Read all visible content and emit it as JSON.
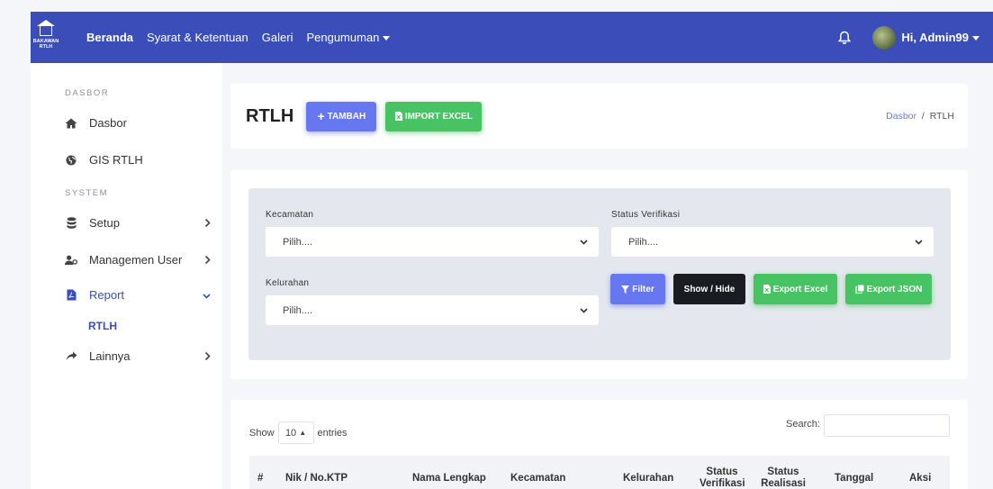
{
  "navbar": {
    "brand_line1": "BAKAWAN",
    "brand_line2": "RTLH",
    "links": [
      "Beranda",
      "Syarat & Ketentuan",
      "Galeri",
      "Pengumuman"
    ],
    "user": "Hi, Admin99"
  },
  "sidebar": {
    "section_dasbor": "DASBOR",
    "dasbor": "Dasbor",
    "gis": "GIS RTLH",
    "section_system": "SYSTEM",
    "setup": "Setup",
    "managemen_user": "Managemen User",
    "report": "Report",
    "report_sub": "RTLH",
    "lainnya": "Lainnya"
  },
  "header": {
    "title": "RTLH",
    "tambah": "TAMBAH",
    "import": "IMPORT EXCEL",
    "breadcrumb_home": "Dasbor",
    "breadcrumb_sep": "/",
    "breadcrumb_current": "RTLH"
  },
  "filter": {
    "kecamatan_label": "Kecamatan",
    "kecamatan_value": "Pilih....",
    "status_label": "Status Verifikasi",
    "status_value": "Pilih....",
    "kelurahan_label": "Kelurahan",
    "kelurahan_value": "Pilih....",
    "btn_filter": "Filter",
    "btn_showhide": "Show / Hide",
    "btn_export_excel": "Export Excel",
    "btn_export_json": "Export JSON"
  },
  "table": {
    "show": "Show",
    "length": "10",
    "entries": "entries",
    "search": "Search:",
    "headers": [
      "#",
      "Nik / No.KTP",
      "Nama Lengkap",
      "Kecamatan",
      "Kelurahan",
      "Status Verifikasi",
      "Status Realisasi",
      "Tanggal",
      "Aksi"
    ]
  },
  "colors": {
    "navbar": "#3b4db8",
    "primary": "#6777ef",
    "success": "#47c363",
    "dark": "#191d21"
  }
}
